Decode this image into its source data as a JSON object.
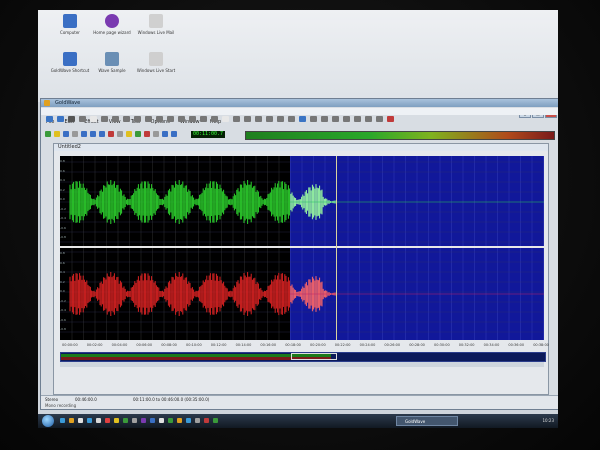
{
  "desktop": {
    "icons": [
      {
        "label": "Computer",
        "color": "#3a6fc4"
      },
      {
        "label": "Home page wizard",
        "color": "#7a3ab0"
      },
      {
        "label": "Windows Live Mail",
        "color": "#d0d0d0"
      },
      {
        "label": "GoldWave Shortcut",
        "color": "#3a6fc4"
      },
      {
        "label": "Wave Sample",
        "color": "#6a8fb5"
      },
      {
        "label": "Windows Live Start",
        "color": "#cfcfcf"
      }
    ]
  },
  "app": {
    "title": "GoldWave",
    "window_buttons": {
      "minimize": "_",
      "maximize": "□",
      "close": "x"
    },
    "menu": [
      "File",
      "Edit",
      "Effect",
      "View",
      "Tool",
      "Options",
      "Window",
      "Help"
    ],
    "toolbar_icon_colors": [
      "#3a74c4",
      "#3a74c4",
      "#555555",
      "#777777",
      "#e7e7e7",
      "#777777",
      "#777777",
      "#777777",
      "#777777",
      "#777777",
      "#777777",
      "#777777",
      "#777777",
      "#777777",
      "#777777",
      "#777777",
      "#e7e7e7",
      "#777777",
      "#777777",
      "#777777",
      "#777777",
      "#777777",
      "#777777",
      "#3a74c4",
      "#777777",
      "#777777",
      "#777777",
      "#777777",
      "#777777",
      "#777777",
      "#777777",
      "#c03a3a"
    ],
    "transport_icon_colors": [
      "#3a9a3a",
      "#e0c020",
      "#3a6fc4",
      "#999999",
      "#3a6fc4",
      "#3a6fc4",
      "#3a6fc4",
      "#c03a3a",
      "#999999",
      "#e0c020",
      "#3a9a3a",
      "#c03a3a",
      "#999999",
      "#3a6fc4",
      "#3a6fc4",
      "#999999",
      "#999999",
      "#999999",
      "#999999",
      "#999999",
      "#3a9a3a",
      "#c03a3a",
      "#3a6fc4"
    ],
    "counter": "00:11:00.7",
    "document": {
      "title": "Untitled2",
      "left_scale": [
        "0.8",
        "0.6",
        "0.4",
        "0.2",
        "0.0",
        "-0.2",
        "-0.4",
        "-0.6",
        "-0.8"
      ],
      "right_scale": [
        "0.8",
        "0.6",
        "0.4",
        "0.2",
        "0.0",
        "-0.2",
        "-0.4",
        "-0.6",
        "-0.8"
      ],
      "timeline": [
        "00:00:00",
        "00:02:00",
        "00:04:00",
        "00:06:00",
        "00:08:00",
        "00:10:00",
        "00:12:00",
        "00:14:00",
        "00:16:00",
        "00:18:00",
        "00:20:00",
        "00:22:00",
        "00:24:00",
        "00:26:00",
        "00:28:00",
        "00:30:00",
        "00:32:00",
        "00:34:00",
        "00:36:00",
        "00:38:00"
      ],
      "colors": {
        "left_wave": "#2ccf2c",
        "left_wave_selected": "#9cffa0",
        "right_wave": "#d82222",
        "right_wave_selected": "#ff6666",
        "selection": "#11189a"
      }
    },
    "status": {
      "channel": "Stereo",
      "length": "00:46:00.0",
      "selection": "00:11:00.0 to 00:46:00.0 (00:35:00.0)",
      "line2": "Mono recording"
    }
  },
  "taskbar": {
    "task_label": "GoldWave",
    "clock": "10:23",
    "quick_launch_colors": [
      "#3a9ad8",
      "#e0a020",
      "#e0e0e0",
      "#3a9ad8",
      "#d8d8d8",
      "#e04040",
      "#e0c020",
      "#3a9a3a",
      "#a0a0a0",
      "#7a3ab0",
      "#3a6fc4",
      "#e0e0e0",
      "#3a9a3a",
      "#e0a020",
      "#3a9ad8",
      "#a0a0a0",
      "#c03a3a",
      "#3a9a3a"
    ]
  }
}
